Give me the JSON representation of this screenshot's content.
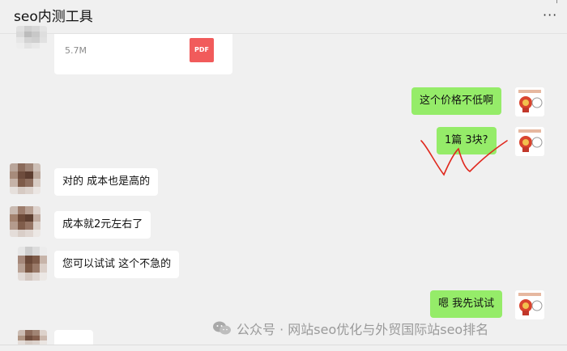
{
  "window": {
    "title": "seo内测工具",
    "more_icon": "more-horizontal-icon"
  },
  "messages": {
    "file": {
      "size": "5.7M",
      "type_label": "PDF",
      "icon": "pdf-file-icon"
    },
    "m1": {
      "text": "这个价格不低啊"
    },
    "m2": {
      "text": "1篇  3块?"
    },
    "m3": {
      "text": "对的 成本也是高的"
    },
    "m4": {
      "text": "成本就2元左右了"
    },
    "m5": {
      "text": "您可以试试 这个不急的"
    },
    "m6": {
      "text": "嗯 我先试试"
    }
  },
  "watermark": {
    "text": "公众号 · 网站seo优化与外贸国际站seo排名",
    "icon": "wechat-icon"
  },
  "colors": {
    "outgoing_bubble": "#95ec69",
    "incoming_bubble": "#ffffff",
    "pdf_red": "#f15b5b",
    "annotation_red": "#e0281e"
  }
}
